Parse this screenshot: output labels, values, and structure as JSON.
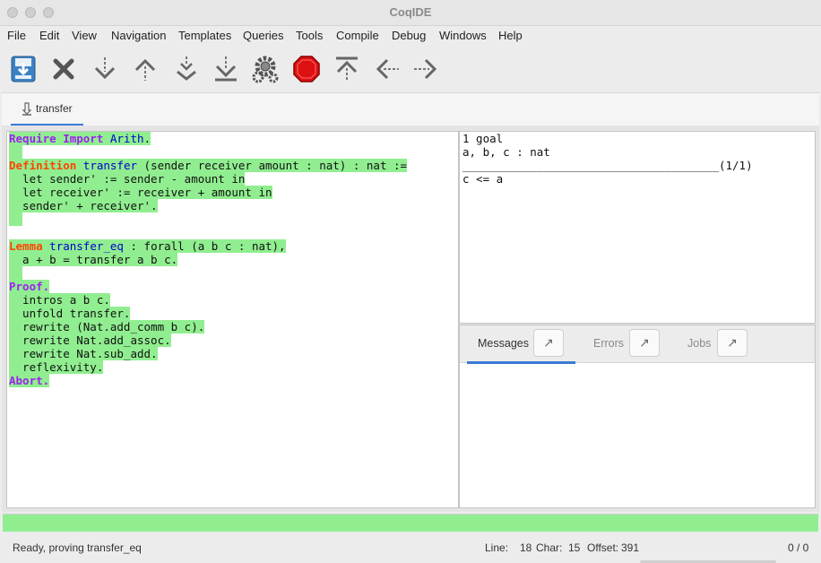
{
  "window": {
    "title": "CoqIDE"
  },
  "menu": [
    "File",
    "Edit",
    "View",
    "Navigation",
    "Templates",
    "Queries",
    "Tools",
    "Compile",
    "Debug",
    "Windows",
    "Help"
  ],
  "toolbar": [
    {
      "icon": "save-icon"
    },
    {
      "icon": "close-icon"
    },
    {
      "icon": "forward-icon"
    },
    {
      "icon": "backward-icon"
    },
    {
      "icon": "go-to-cursor-icon"
    },
    {
      "icon": "go-to-end-icon"
    },
    {
      "icon": "gear-icon"
    },
    {
      "icon": "interrupt-icon"
    },
    {
      "icon": "go-to-start-icon"
    },
    {
      "icon": "previous-icon"
    },
    {
      "icon": "next-icon"
    }
  ],
  "document_tab": {
    "label": "transfer"
  },
  "editor": {
    "lines": [
      [
        [
          "Require Import",
          "kw"
        ],
        [
          " ",
          "tx"
        ],
        [
          "Arith",
          "nm"
        ],
        [
          ".",
          "tx"
        ]
      ],
      [
        [
          "  ",
          "tx"
        ]
      ],
      [
        [
          "Definition",
          "kd"
        ],
        [
          " ",
          "tx"
        ],
        [
          "transfer",
          "nm"
        ],
        [
          " (sender receiver amount : nat) : nat :=",
          "tx"
        ]
      ],
      [
        [
          "  let sender' := sender - amount in",
          "tx"
        ]
      ],
      [
        [
          "  let receiver' := receiver + amount in",
          "tx"
        ]
      ],
      [
        [
          "  sender' + receiver'.",
          "tx"
        ]
      ],
      [
        [
          "  ",
          "tx"
        ]
      ],
      [],
      [
        [
          "Lemma",
          "kd"
        ],
        [
          " ",
          "tx"
        ],
        [
          "transfer_eq",
          "nm"
        ],
        [
          " : forall (a b c : nat),",
          "tx"
        ]
      ],
      [
        [
          "  a + b = transfer a b c.",
          "tx"
        ]
      ],
      [
        [
          "  ",
          "tx"
        ]
      ],
      [
        [
          "Proof.",
          "kw"
        ]
      ],
      [
        [
          "  intros a b c.",
          "tx"
        ]
      ],
      [
        [
          "  unfold transfer.",
          "tx"
        ]
      ],
      [
        [
          "  rewrite (Nat.add_comm b c).",
          "tx"
        ]
      ],
      [
        [
          "  rewrite Nat.add_assoc.",
          "tx"
        ]
      ],
      [
        [
          "  rewrite Nat.sub_add.",
          "tx"
        ]
      ],
      [
        [
          "  reflexivity.",
          "tx"
        ]
      ],
      [
        [
          "Abort.",
          "kw"
        ]
      ]
    ]
  },
  "goals": {
    "count": "1 goal",
    "hypothesis": "a, b, c : nat",
    "separator": "______________________________________(1/1)",
    "conclusion": "c <= a"
  },
  "messages_pane": {
    "tabs": [
      {
        "label": "Messages",
        "active": true,
        "color": "#333333"
      },
      {
        "label": "Errors",
        "active": false,
        "color": "#8a8a8a"
      },
      {
        "label": "Jobs",
        "active": false,
        "color": "#8a8a8a"
      }
    ],
    "detach_glyph": "↗"
  },
  "status": {
    "message": "Ready, proving transfer_eq",
    "line_label": "Line:",
    "line": "18",
    "char_label": "Char:",
    "char": "15",
    "offset_label": "Offset:",
    "offset": "391",
    "jobs": "0 / 0"
  },
  "colors": {
    "processed": "#90ee90",
    "accent": "#3a7bd5"
  }
}
